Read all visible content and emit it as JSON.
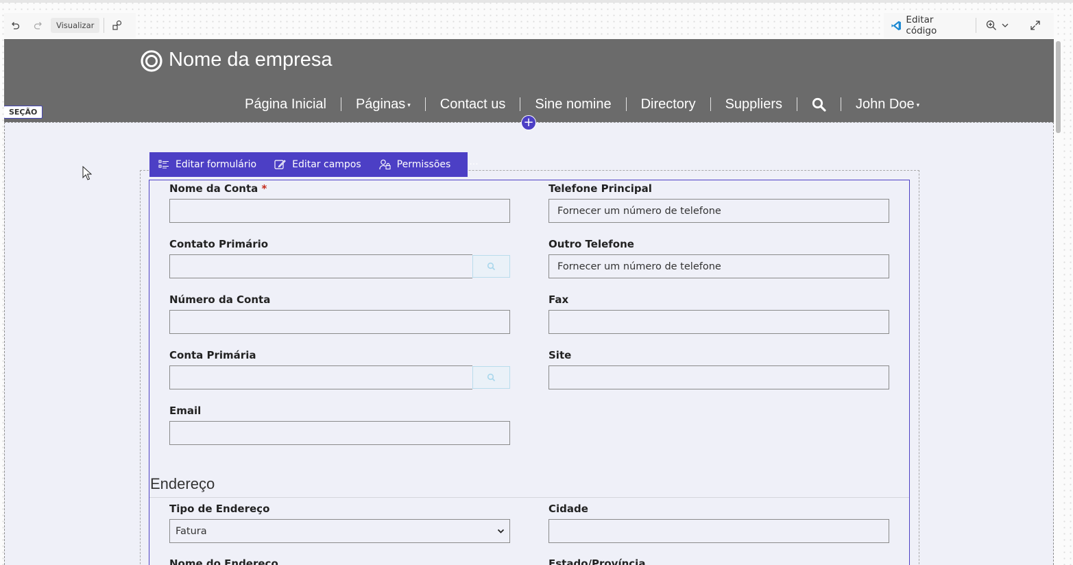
{
  "toolbar": {
    "preview_label": "Visualizar",
    "edit_code_label": "Editar código"
  },
  "site": {
    "company_name": "Nome da empresa",
    "nav": [
      {
        "label": "Página Inicial"
      },
      {
        "label": "Páginas",
        "dropdown": true
      },
      {
        "label": "Contact us"
      },
      {
        "label": "Sine nomine"
      },
      {
        "label": "Directory"
      },
      {
        "label": "Suppliers"
      },
      {
        "label": "search-icon",
        "icon": true
      },
      {
        "label": "John Doe",
        "dropdown": true
      }
    ],
    "caret": "▾"
  },
  "section_label": "SEÇÃO",
  "add_symbol": "+",
  "form_toolbar": {
    "edit_form": "Editar formulário",
    "edit_fields": "Editar campos",
    "permissions": "Permissões",
    "more": "···"
  },
  "form": {
    "fields": {
      "account_name": {
        "label": "Nome da Conta",
        "required_mark": "*",
        "value": ""
      },
      "main_phone": {
        "label": "Telefone Principal",
        "value": "Fornecer um número de telefone"
      },
      "primary_contact": {
        "label": "Contato Primário",
        "value": ""
      },
      "other_phone": {
        "label": "Outro Telefone",
        "value": "Fornecer um número de telefone"
      },
      "account_number": {
        "label": "Número da Conta",
        "value": ""
      },
      "fax": {
        "label": "Fax",
        "value": ""
      },
      "parent_account": {
        "label": "Conta Primária",
        "value": ""
      },
      "website": {
        "label": "Site",
        "value": ""
      },
      "email": {
        "label": "Email",
        "value": ""
      }
    },
    "address_section": {
      "title": "Endereço",
      "address_type": {
        "label": "Tipo de Endereço",
        "selected": "Fatura"
      },
      "city": {
        "label": "Cidade",
        "value": ""
      },
      "address_name": {
        "label": "Nome do Endereço"
      },
      "state": {
        "label": "Estado/Província"
      }
    }
  },
  "colors": {
    "accent": "#4c3fc5",
    "header_bg": "#6b6b6b",
    "canvas_bg": "#eff0f8",
    "required": "#c42b1c",
    "vscode_blue": "#1f8ad2"
  }
}
